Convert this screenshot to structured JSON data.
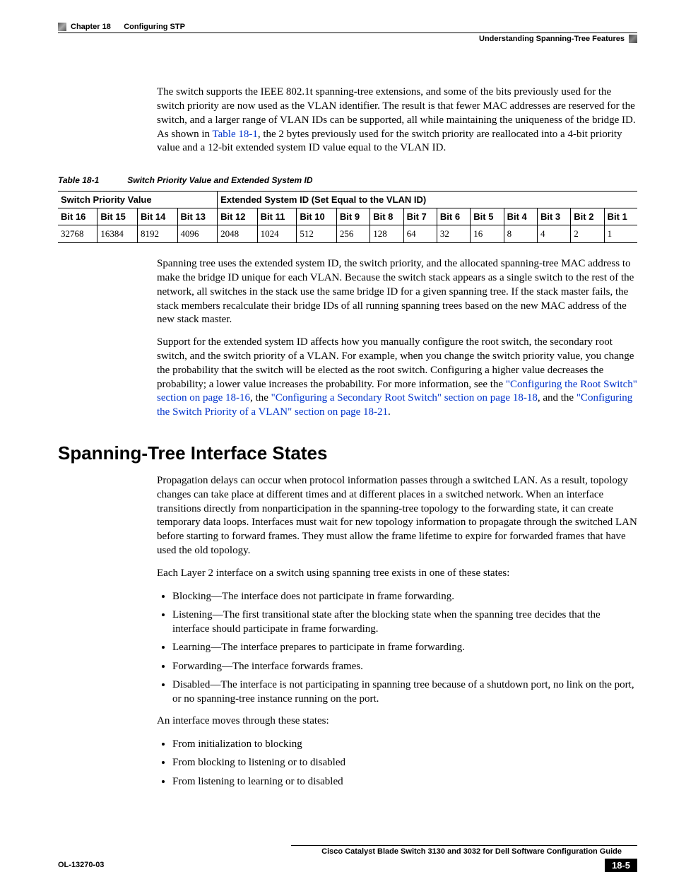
{
  "header": {
    "chapter_label": "Chapter 18      Configuring STP",
    "section_label": "Understanding Spanning-Tree Features"
  },
  "intro_para_pre": "The switch supports the IEEE 802.1t spanning-tree extensions, and some of the bits previously used for the switch priority are now used as the VLAN identifier. The result is that fewer MAC addresses are reserved for the switch, and a larger range of VLAN IDs can be supported, all while maintaining the uniqueness of the bridge ID. As shown in ",
  "intro_link": "Table 18-1",
  "intro_para_post": ", the 2 bytes previously used for the switch priority are reallocated into a 4-bit priority value and a 12-bit extended system ID value equal to the VLAN ID.",
  "table_caption_num": "Table 18-1",
  "table_caption_title": "Switch Priority Value and Extended System ID",
  "table": {
    "group1": "Switch Priority Value",
    "group2": "Extended System ID (Set Equal to the VLAN ID)",
    "bits": [
      "Bit 16",
      "Bit 15",
      "Bit 14",
      "Bit 13",
      "Bit 12",
      "Bit 11",
      "Bit 10",
      "Bit 9",
      "Bit 8",
      "Bit 7",
      "Bit 6",
      "Bit 5",
      "Bit 4",
      "Bit 3",
      "Bit 2",
      "Bit 1"
    ],
    "vals": [
      "32768",
      "16384",
      "8192",
      "4096",
      "2048",
      "1024",
      "512",
      "256",
      "128",
      "64",
      "32",
      "16",
      "8",
      "4",
      "2",
      "1"
    ]
  },
  "para_after_table1": "Spanning tree uses the extended system ID, the switch priority, and the allocated spanning-tree MAC address to make the bridge ID unique for each VLAN. Because the switch stack appears as a single switch to the rest of the network, all switches in the stack use the same bridge ID for a given spanning tree. If the stack master fails, the stack members recalculate their bridge IDs of all running spanning trees based on the new MAC address of the new stack master.",
  "para_after_table2_pre": "Support for the extended system ID affects how you manually configure the root switch, the secondary root switch, and the switch priority of a VLAN. For example, when you change the switch priority value, you change the probability that the switch will be elected as the root switch. Configuring a higher value decreases the probability; a lower value increases the probability. For more information, see the ",
  "link_a": "\"Configuring the Root Switch\" section on page 18-16",
  "mid_a": ", the ",
  "link_b": "\"Configuring a Secondary Root Switch\" section on page 18-18",
  "mid_b": ", and the ",
  "link_c": "\"Configuring the Switch Priority of a VLAN\" section on page 18-21",
  "post_c": ".",
  "h2": "Spanning-Tree Interface States",
  "states_intro": "Propagation delays can occur when protocol information passes through a switched LAN. As a result, topology changes can take place at different times and at different places in a switched network. When an interface transitions directly from nonparticipation in the spanning-tree topology to the forwarding state, it can create temporary data loops. Interfaces must wait for new topology information to propagate through the switched LAN before starting to forward frames. They must allow the frame lifetime to expire for forwarded frames that have used the old topology.",
  "states_lead": "Each Layer 2 interface on a switch using spanning tree exists in one of these states:",
  "states_list": [
    "Blocking—The interface does not participate in frame forwarding.",
    "Listening—The first transitional state after the blocking state when the spanning tree decides that the interface should participate in frame forwarding.",
    "Learning—The interface prepares to participate in frame forwarding.",
    "Forwarding—The interface forwards frames.",
    "Disabled—The interface is not participating in spanning tree because of a shutdown port, no link on the port, or no spanning-tree instance running on the port."
  ],
  "moves_lead": "An interface moves through these states:",
  "moves_list": [
    "From initialization to blocking",
    "From blocking to listening or to disabled",
    "From listening to learning or to disabled"
  ],
  "footer": {
    "book_title": "Cisco Catalyst Blade Switch 3130 and 3032 for Dell Software Configuration Guide",
    "doc_id": "OL-13270-03",
    "page_num": "18-5"
  }
}
